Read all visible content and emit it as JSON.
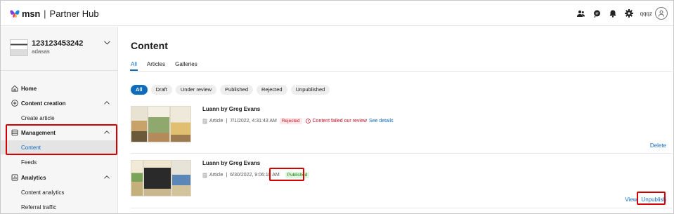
{
  "header": {
    "brand": "msn",
    "separator": "|",
    "product": "Partner Hub",
    "username": "qqqz",
    "icons": [
      "people-icon",
      "chat-icon",
      "bell-icon",
      "gear-icon",
      "avatar-icon"
    ]
  },
  "sidebar": {
    "account_name": "123123453242",
    "account_sub": "adasas",
    "items": [
      {
        "label": "Home",
        "icon": "home-icon"
      },
      {
        "label": "Content creation",
        "icon": "plus-circle-icon"
      },
      {
        "label": "Create article"
      },
      {
        "label": "Management",
        "icon": "database-icon"
      },
      {
        "label": "Content"
      },
      {
        "label": "Feeds"
      },
      {
        "label": "Analytics",
        "icon": "chart-icon"
      },
      {
        "label": "Content analytics"
      },
      {
        "label": "Referral traffic"
      }
    ]
  },
  "main": {
    "title": "Content",
    "tabs": [
      "All",
      "Articles",
      "Galleries"
    ],
    "filters": [
      "All",
      "Draft",
      "Under review",
      "Published",
      "Rejected",
      "Unpublished"
    ],
    "cards": [
      {
        "title": "Luann by Greg Evans",
        "type": "Article",
        "date": "7/1/2022, 4:31:43 AM",
        "status": "Rejected",
        "message": "Content failed our review",
        "details_link": "See details",
        "actions": [
          "Delete"
        ]
      },
      {
        "title": "Luann by Greg Evans",
        "type": "Article",
        "date": "6/30/2022, 9:06:18 AM",
        "status": "Published",
        "actions": [
          "View",
          "Unpublish"
        ]
      }
    ]
  },
  "colors": {
    "accent": "#0f6cbd",
    "highlight": "#d40000",
    "rejected": "#c50f1f",
    "published": "#107c10"
  }
}
